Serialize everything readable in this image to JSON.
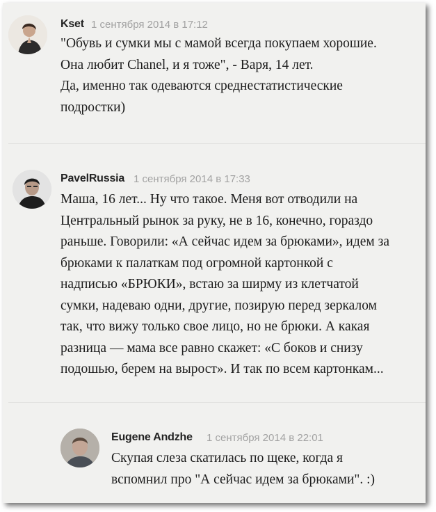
{
  "comments": [
    {
      "author": "Kset",
      "date": "1 сентября 2014 в 17:12",
      "lines": [
        "\"Обувь и сумки мы с мамой всегда покупаем хорошие.",
        "Она любит Chanel, и я тоже\", - Варя, 14 лет.",
        "Да, именно так одеваются среднестатистические",
        "подростки)"
      ]
    },
    {
      "author": "PavelRussia",
      "date": "1 сентября 2014 в 17:33",
      "lines": [
        "Маша, 16 лет... Ну что такое. Меня вот отводили на",
        "Центральный рынок за руку, не в 16, конечно, гораздо",
        "раньше. Говорили: «А сейчас идем за брюками», идем за",
        "брюками к палаткам под огромной картонкой с",
        "надписью «БРЮКИ», встаю за ширму из клетчатой",
        "сумки, надеваю одни, другие, позирую перед зеркалом",
        "так, что вижу только свое лицо, но не брюки. А какая",
        "разница — мама все равно скажет: «С боков и снизу",
        "подошью, берем на вырост». И так по всем картонкам..."
      ]
    },
    {
      "author": "Eugene Andzhe",
      "date": "1 сентября 2014 в 22:01",
      "lines": [
        "Скупая слеза скатилась по щеке, когда я",
        "вспомнил про \"А сейчас идем за брюками\". :)"
      ]
    }
  ]
}
